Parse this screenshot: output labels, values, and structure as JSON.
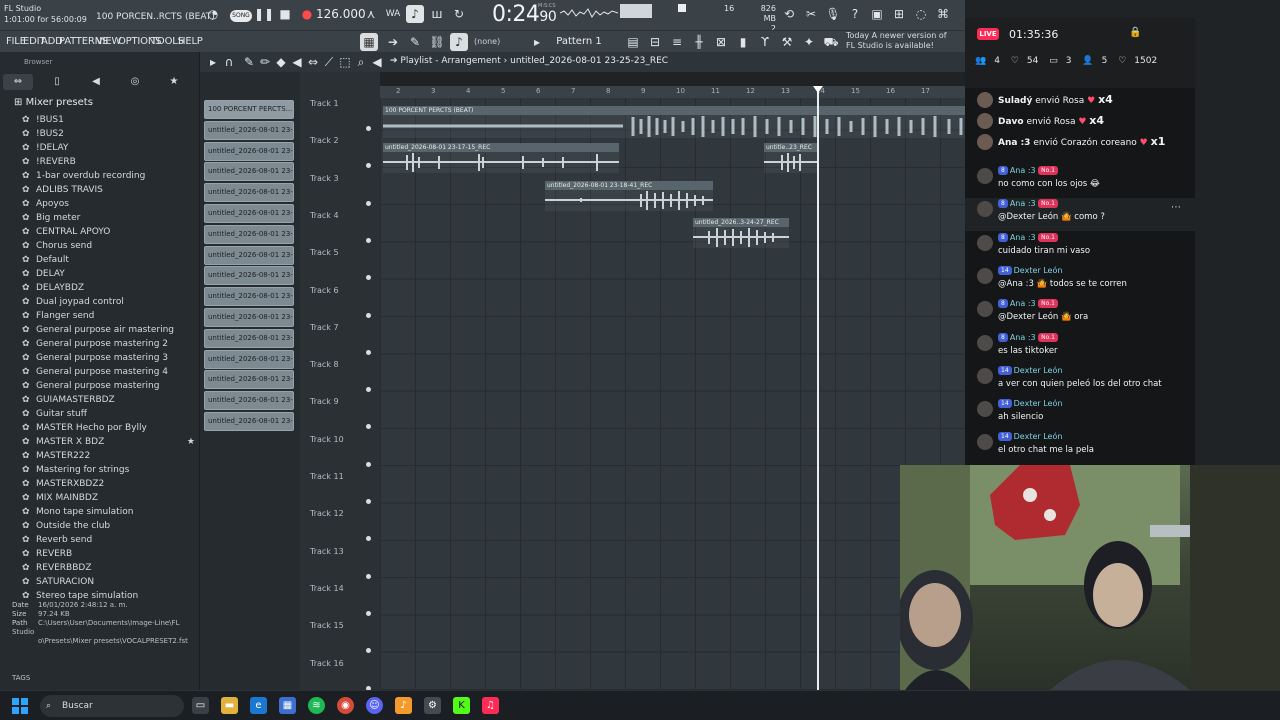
{
  "app": {
    "title": "FL Studio",
    "position": "1:01:00 for 56:00:09",
    "song_name": "100 PORCEN..RCTS (BEAT)",
    "mode_label": "SONG",
    "tempo": "126.000",
    "time_main": "0:24",
    "time_frac": "90",
    "time_unit": "M:S:CS",
    "cpu": "16",
    "memory": "826 MB",
    "voices": "2"
  },
  "menu": [
    "FILE",
    "EDIT",
    "ADD",
    "PATTERNS",
    "VIEW",
    "OPTIONS",
    "TOOLS",
    "HELP"
  ],
  "pattern": {
    "current": "Pattern 1",
    "none_label": "(none)"
  },
  "news": {
    "line1": "Today  A newer version of",
    "line2": "FL Studio is available!"
  },
  "browser": {
    "title": "Browser",
    "section": "Mixer presets",
    "presets": [
      "!BUS1",
      "!BUS2",
      "!DELAY",
      "!REVERB",
      "1-bar overdub recording",
      "ADLIBS TRAVIS",
      "Apoyos",
      "Big meter",
      "CENTRAL APOYO",
      "Chorus send",
      "Default",
      "DELAY",
      "DELAYBDZ",
      "Dual joypad control",
      "Flanger send",
      "General purpose air mastering",
      "General purpose mastering 2",
      "General purpose mastering 3",
      "General purpose mastering 4",
      "General purpose mastering",
      "GUIAMASTERBDZ",
      "Guitar stuff",
      "MASTER Hecho por Bylly",
      "MASTER X BDZ",
      "MASTER222",
      "Mastering for strings",
      "MASTERXBDZ2",
      "MIX MAINBDZ",
      "Mono tape simulation",
      "Outside the club",
      "Reverb send",
      "REVERB",
      "REVERBBDZ",
      "SATURACION",
      "Stereo tape simulation"
    ],
    "date_label": "Date",
    "date": "16/01/2026 2:48:12 a. m.",
    "size_label": "Size",
    "size": "97.24 KB",
    "path_label": "Path",
    "path1": "C:\\Users\\User\\Documents\\Image-Line\\FL Studio",
    "path2": "o\\Presets\\Mixer presets\\VOCALPRESET2.fst",
    "tags": "TAGS"
  },
  "playlist": {
    "title": "Playlist - Arrangement",
    "breadcrumb": "untitled_2026-08-01 23-25-23_REC",
    "picker_clips": [
      "100 PORCENT PERCTS...",
      "untitled_2026-08-01 23-...",
      "untitled_2026-08-01 23-...",
      "untitled_2026-08-01 23-...",
      "untitled_2026-08-01 23-...",
      "untitled_2026-08-01 23-...",
      "untitled_2026-08-01 23-...",
      "untitled_2026-08-01 23-...",
      "untitled_2026-08-01 23-...",
      "untitled_2026-08-01 23-...",
      "untitled_2026-08-01 23-...",
      "untitled_2026-08-01 23-...",
      "untitled_2026-08-01 23-...",
      "untitled_2026-08-01 23-...",
      "untitled_2026-08-01 23-...",
      "untitled_2026-08-01 23-..."
    ],
    "tracks": [
      "Track 1",
      "Track 2",
      "Track 3",
      "Track 4",
      "Track 5",
      "Track 6",
      "Track 7",
      "Track 8",
      "Track 9",
      "Track 10",
      "Track 11",
      "Track 12",
      "Track 13",
      "Track 14",
      "Track 15",
      "Track 16"
    ],
    "bars": [
      "2",
      "3",
      "4",
      "5",
      "6",
      "7",
      "8",
      "9",
      "10",
      "11",
      "12",
      "13",
      "14",
      "15",
      "16",
      "17"
    ],
    "clips": {
      "beat": "100 PORCENT PERCTS (BEAT)",
      "rec1": "untitled_2026-08-01 23-17-15_REC",
      "rec1b": "untitle..23_REC",
      "rec2": "untitled_2026-08-01 23-18-41_REC",
      "rec3": "untitled_2026..3-24-27_REC"
    }
  },
  "live": {
    "badge": "LIVE",
    "time": "01:35:36",
    "stats": {
      "viewers": "4",
      "likes": "54",
      "shares": "3",
      "people": "5",
      "hearts": "1502"
    },
    "gifts": [
      {
        "user": "Suladý",
        "action": "envió Rosa",
        "mult": "x4"
      },
      {
        "user": "Davo",
        "action": "envió Rosa",
        "mult": "x4"
      },
      {
        "user": "Ana :3",
        "action": "envió Corazón coreano",
        "mult": "x1"
      }
    ],
    "messages": [
      {
        "user": "Ana :3",
        "level": "8",
        "rank": "No.1",
        "text": "no como con los ojos 😂"
      },
      {
        "user": "Ana :3",
        "level": "8",
        "rank": "No.1",
        "text": "@Dexter León 🤷 como ?"
      },
      {
        "user": "Ana :3",
        "level": "8",
        "rank": "No.1",
        "text": "cuidado tiran mi vaso"
      },
      {
        "user": "Dexter León",
        "level": "14",
        "rank": "",
        "text": "@Ana :3 🤷 todos se te corren"
      },
      {
        "user": "Ana :3",
        "level": "8",
        "rank": "No.1",
        "text": "@Dexter León 🤷 ora"
      },
      {
        "user": "Ana :3",
        "level": "8",
        "rank": "No.1",
        "text": "es las tiktoker"
      },
      {
        "user": "Dexter León",
        "level": "14",
        "rank": "",
        "text": "a ver con quien peleó los del otro chat"
      },
      {
        "user": "Dexter León",
        "level": "14",
        "rank": "",
        "text": "ah silencio"
      },
      {
        "user": "Dexter León",
        "level": "14",
        "rank": "",
        "text": "el otro chat me la pela"
      }
    ]
  },
  "taskbar": {
    "search": "Buscar"
  },
  "colors": {
    "accent": "#ff2a55",
    "fl_bg": "#30383d",
    "clip": "#7d8a92",
    "username": "#7fd3e6"
  }
}
